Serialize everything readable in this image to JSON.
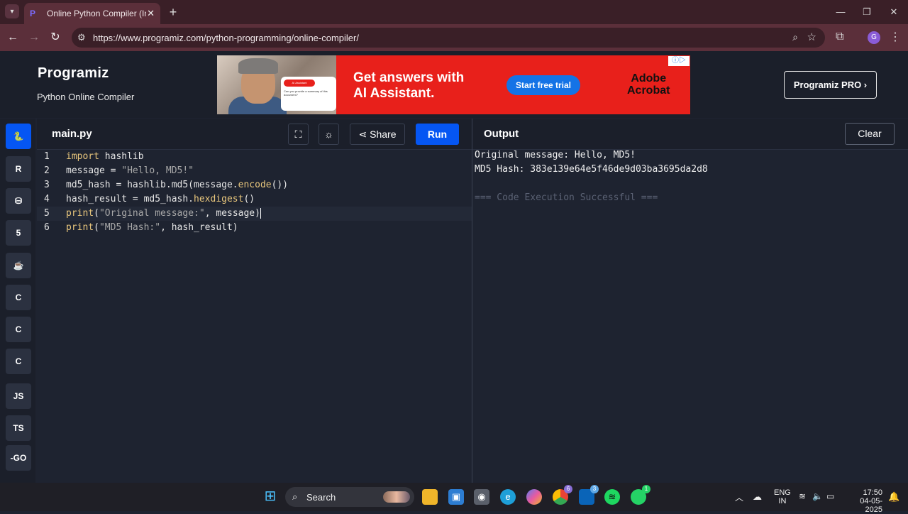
{
  "browser": {
    "tab_title": "Online Python Compiler (Interpreter)",
    "url": "https://www.programiz.com/python-programming/online-compiler/"
  },
  "header": {
    "logo": "Programiz",
    "subtitle": "Python Online Compiler",
    "pro_button": "Programiz PRO ›"
  },
  "ad": {
    "headline_1": "Get answers with",
    "headline_2": "AI Assistant.",
    "cta": "Start free trial",
    "brand_1": "Adobe",
    "brand_2": "Acrobat",
    "bubble_pill": "AI Assistant",
    "bubble_text": "Can you provide a summary of this document?"
  },
  "sidebar": {
    "languages": [
      {
        "name": "python",
        "label": "🐍",
        "active": true
      },
      {
        "name": "r",
        "label": "R",
        "active": false
      },
      {
        "name": "sql",
        "label": "⛁",
        "active": false
      },
      {
        "name": "html",
        "label": "5",
        "active": false
      },
      {
        "name": "java",
        "label": "☕",
        "active": false
      },
      {
        "name": "c",
        "label": "C",
        "active": false
      },
      {
        "name": "cpp",
        "label": "C",
        "active": false
      },
      {
        "name": "csharp",
        "label": "C",
        "active": false
      },
      {
        "name": "js",
        "label": "JS",
        "active": false
      },
      {
        "name": "ts",
        "label": "TS",
        "active": false
      },
      {
        "name": "go",
        "label": "-GO",
        "active": false
      }
    ]
  },
  "editor": {
    "filename": "main.py",
    "share_label": "Share",
    "run_label": "Run",
    "lines": [
      {
        "no": "1",
        "code": "import hashlib"
      },
      {
        "no": "2",
        "code": "message = \"Hello, MD5!\""
      },
      {
        "no": "3",
        "code": "md5_hash = hashlib.md5(message.encode())"
      },
      {
        "no": "4",
        "code": "hash_result = md5_hash.hexdigest()"
      },
      {
        "no": "5",
        "code": "print(\"Original message:\", message)"
      },
      {
        "no": "6",
        "code": "print(\"MD5 Hash:\", hash_result)"
      }
    ]
  },
  "output": {
    "title": "Output",
    "clear_label": "Clear",
    "lines": [
      "Original message: Hello, MD5!",
      "MD5 Hash: 383e139e64e5f46de9d03ba3695da2d8",
      "",
      "=== Code Execution Successful ==="
    ]
  },
  "taskbar": {
    "search_label": "Search",
    "lang_1": "ENG",
    "lang_2": "IN",
    "time": "17:50",
    "date": "04-05-2025",
    "chrome_badge": "6",
    "outlook_badge": "3",
    "whatsapp_badge": "1"
  }
}
